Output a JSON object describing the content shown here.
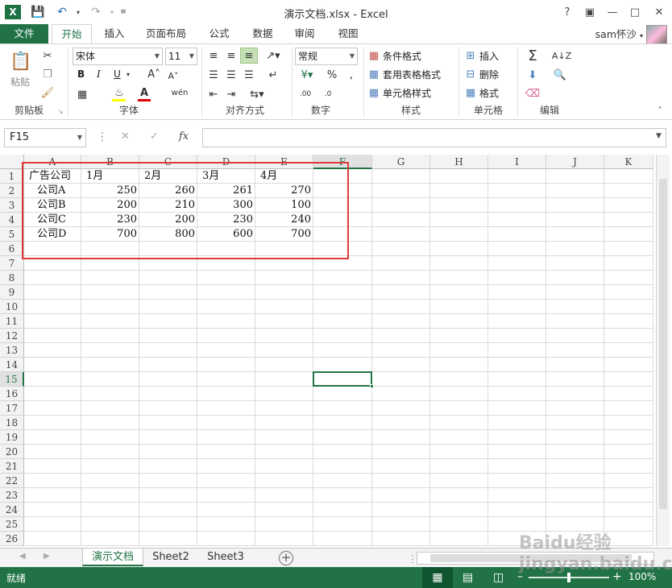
{
  "title_bar": {
    "title": "演示文档.xlsx - Excel",
    "help": "?",
    "icons": [
      "excel-logo-icon",
      "save-icon",
      "undo-icon",
      "redo-icon",
      "customize-icon"
    ]
  },
  "tabs": [
    {
      "label": "文件"
    },
    {
      "label": "开始"
    },
    {
      "label": "插入"
    },
    {
      "label": "页面布局"
    },
    {
      "label": "公式"
    },
    {
      "label": "数据"
    },
    {
      "label": "审阅"
    },
    {
      "label": "视图"
    }
  ],
  "user": {
    "name": "sam怀沙"
  },
  "ribbon": {
    "clipboard": {
      "label": "剪贴板",
      "paste": "粘贴"
    },
    "font": {
      "label": "字体",
      "font_name": "宋体",
      "font_size": "11",
      "bold": "B",
      "italic": "I",
      "underline": "U"
    },
    "alignment": {
      "label": "对齐方式"
    },
    "number": {
      "label": "数字",
      "format": "常规"
    },
    "styles": {
      "label": "样式",
      "conditional": "条件格式",
      "table": "套用表格格式",
      "cell_styles": "单元格样式"
    },
    "cells": {
      "label": "单元格",
      "insert": "插入",
      "delete": "删除",
      "format": "格式"
    },
    "editing": {
      "label": "编辑"
    }
  },
  "formula_bar": {
    "name_box": "F15",
    "cancel": "✕",
    "enter": "✓",
    "fx": "fx",
    "content": ""
  },
  "columns": [
    "A",
    "B",
    "C",
    "D",
    "E",
    "F",
    "G",
    "H",
    "I",
    "J",
    "K"
  ],
  "selected_column": "F",
  "rows": [
    "1",
    "2",
    "3",
    "4",
    "5",
    "6",
    "7",
    "8",
    "9",
    "10",
    "11",
    "12",
    "13",
    "14",
    "15",
    "16",
    "17",
    "18",
    "19",
    "20",
    "21",
    "22",
    "23",
    "24",
    "25",
    "26"
  ],
  "selected_row": "15",
  "sheet": {
    "header": [
      "广告公司",
      "1月",
      "2月",
      "3月",
      "4月"
    ],
    "data": [
      {
        "company": "公司A",
        "values": [
          "250",
          "260",
          "261",
          "270"
        ]
      },
      {
        "company": "公司B",
        "values": [
          "200",
          "210",
          "300",
          "100"
        ]
      },
      {
        "company": "公司C",
        "values": [
          "230",
          "200",
          "230",
          "240"
        ]
      },
      {
        "company": "公司D",
        "values": [
          "700",
          "800",
          "600",
          "700"
        ]
      }
    ]
  },
  "sheet_tabs": [
    "演示文档",
    "Sheet2",
    "Sheet3"
  ],
  "status": {
    "ready": "就绪",
    "zoom": "100%"
  },
  "watermark": "Baidu经验 jingyan.baidu.com",
  "colors": {
    "accent": "#217346",
    "highlight_box": "#e03a3a"
  }
}
